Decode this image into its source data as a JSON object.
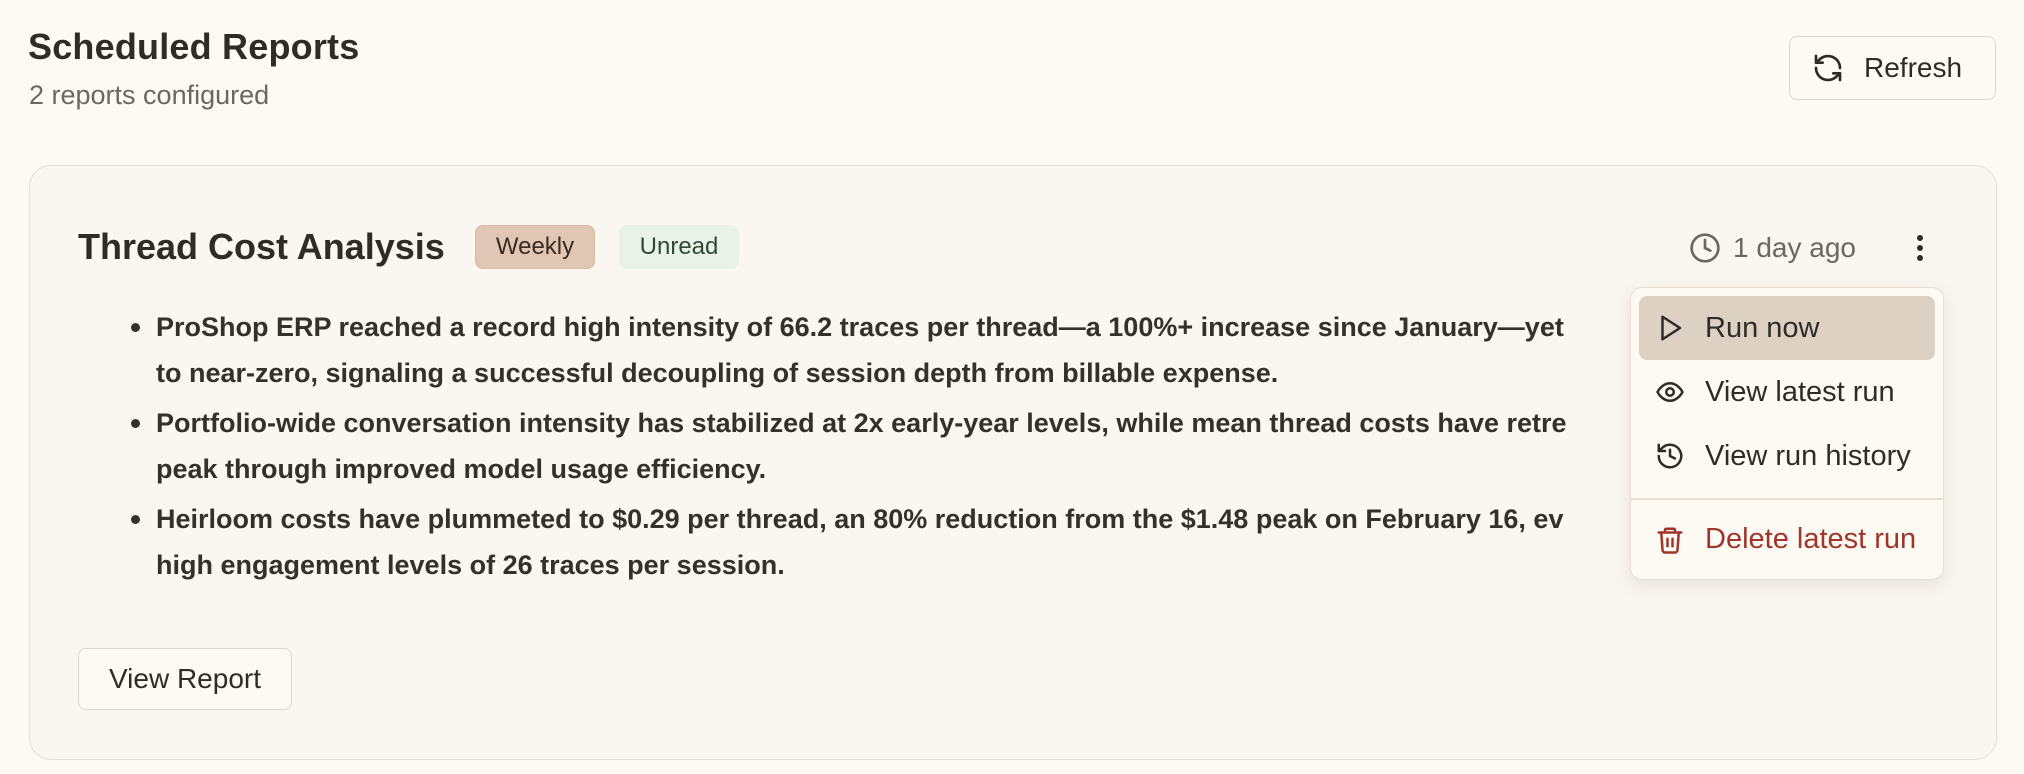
{
  "header": {
    "title": "Scheduled Reports",
    "subtitle": "2 reports configured",
    "refresh_label": "Refresh"
  },
  "report": {
    "title": "Thread Cost Analysis",
    "frequency_badge": "Weekly",
    "status_badge": "Unread",
    "last_run": "1 day ago",
    "summary": [
      "ProShop ERP reached a record high intensity of 66.2 traces per thread—a 100%+ increase since January—yet\nto near-zero, signaling a successful decoupling of session depth from billable expense.",
      "Portfolio-wide conversation intensity has stabilized at 2x early-year levels, while mean thread costs have retre\npeak through improved model usage efficiency.",
      "Heirloom costs have plummeted to $0.29 per thread, an 80% reduction from the $1.48 peak on February 16, ev\nhigh engagement levels of 26 traces per session."
    ],
    "view_label": "View Report"
  },
  "menu": {
    "items": [
      {
        "label": "Run now",
        "icon": "play-icon"
      },
      {
        "label": "View latest run",
        "icon": "eye-icon"
      },
      {
        "label": "View run history",
        "icon": "history-icon"
      },
      {
        "label": "Delete latest run",
        "icon": "trash-icon"
      }
    ]
  },
  "colors": {
    "background": "#fdfaf3",
    "weekly_badge": "#dfc6b5",
    "unread_badge": "#e8f2e9",
    "danger": "#a0352b",
    "active_menu": "#ddd1c4"
  }
}
